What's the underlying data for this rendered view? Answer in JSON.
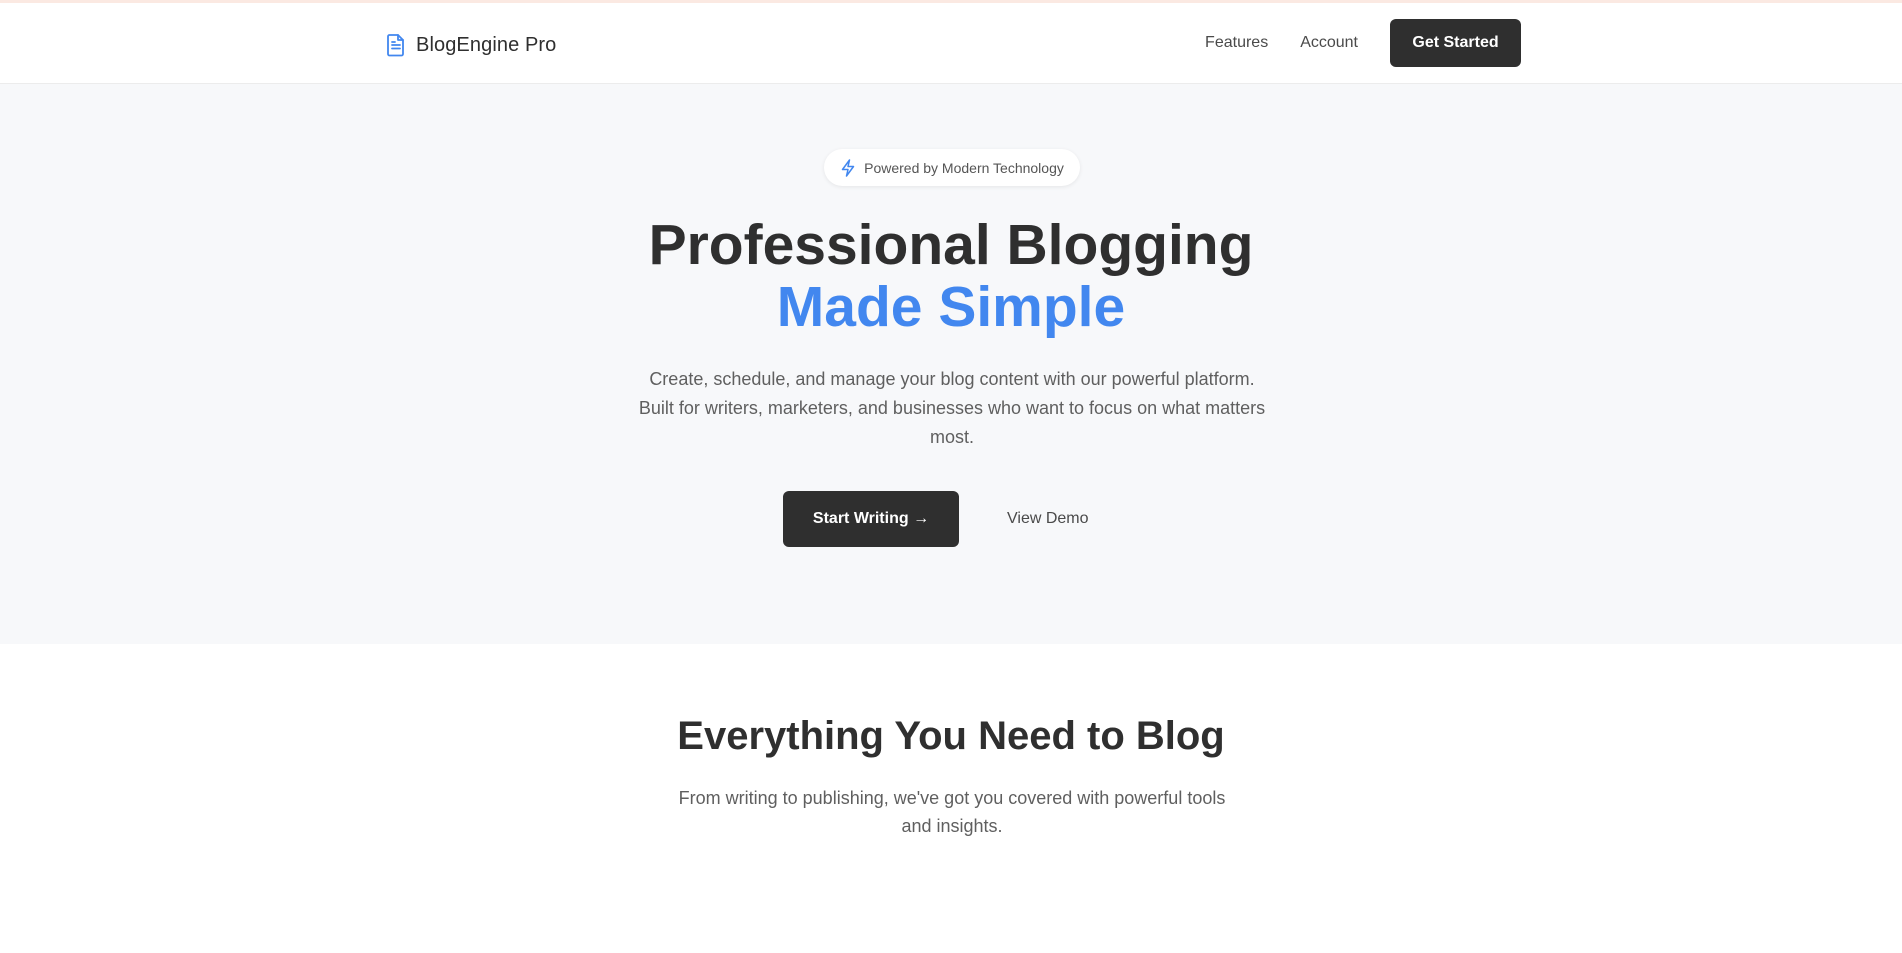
{
  "header": {
    "brand_name": "BlogEngine Pro",
    "brand_icon": "document-icon",
    "nav": [
      {
        "label": "Features"
      },
      {
        "label": "Account"
      }
    ],
    "cta_label": "Get Started"
  },
  "hero": {
    "badge_icon": "lightning-icon",
    "badge_text": "Powered by Modern Technology",
    "title_line1": "Professional Blogging",
    "title_line2": "Made Simple",
    "subtitle": "Create, schedule, and manage your blog content with our powerful platform. Built for writers, marketers, and businesses who want to focus on what matters most.",
    "primary_button": "Start Writing →",
    "secondary_button": "View Demo"
  },
  "features": {
    "title": "Everything You Need to Blog",
    "subtitle": "From writing to publishing, we've got you covered with powerful tools and insights."
  },
  "colors": {
    "accent": "#4287ef",
    "dark": "#2f2f2f",
    "hero_bg": "#f7f8fa"
  }
}
